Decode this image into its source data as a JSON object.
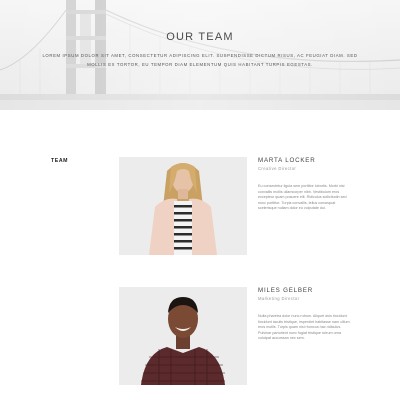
{
  "hero": {
    "title": "OUR TEAM",
    "subtitle": "LOREM IPSUM DOLOR SIT AMET, CONSECTETUR ADIPISCING ELIT. SUSPENDISSE DICTUM RISUS, AC FEUGIAT DIAM. SED MOLLIS EX TORTOR, EU TEMPOR DIAM ELEMENTUM QUIS HABITANT TURPIS EGESTAS."
  },
  "section": {
    "label": "TEAM"
  },
  "members": [
    {
      "name": "MARTA LOCKER",
      "role": "Creative Director",
      "bio": "Eu consectetur ligula sem porttitor lobortis. Morbi nisi convallis mollis ullamcorper nibh. Vestibulum eros excepteur quam posuere elit. Ridiculus sollicitudin sed nunc porttitor. Turpis convallis, tellus consequat scelerisque nullam dolor eu vulputate dui."
    },
    {
      "name": "MILES GELBER",
      "role": "Marketing Director",
      "bio": "Nulla pharetra dolor nunc rutrum. Aliquet duis tincidunt tincidunt iaculis tristique, imperdiet habitasse nam cillum eros mollis. Turpis quam nisi rhoncus hac ridiculus. Pulvinar parturient nunc fugiat tristique rutrum urna volutpat accumsan nec sem."
    }
  ],
  "colors": {
    "background": "#ffffff",
    "hero_background": "#efefef",
    "heading": "#444444",
    "body_text": "#888888"
  }
}
